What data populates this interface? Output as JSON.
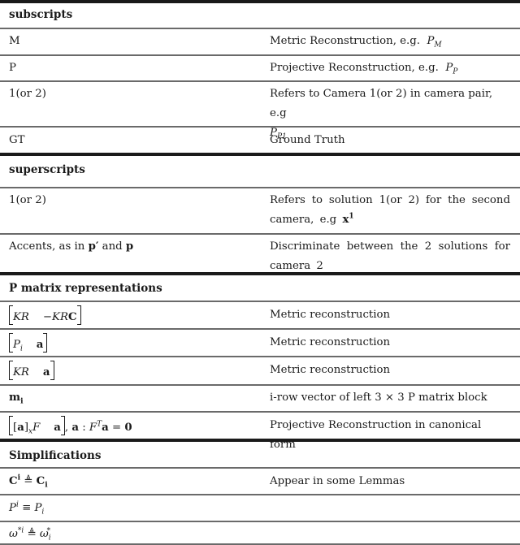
{
  "sections": [
    {
      "header": "subscripts",
      "rows": [
        {
          "symbol": "M",
          "description": "Metric Reconstruction, e.g.",
          "desc_math": "P",
          "desc_math_sub": "M"
        },
        {
          "symbol": "P",
          "description": "Projective Reconstruction, e.g.",
          "desc_math": "P",
          "desc_math_sub": "P"
        },
        {
          "symbol": "1(or 2)",
          "description": "Refers to Camera 1(or 2) in camera pair, e.g",
          "desc_math": "P",
          "desc_math_sub": "P1"
        },
        {
          "symbol": "GT",
          "description": "Ground Truth"
        }
      ]
    },
    {
      "header": "superscripts",
      "rows": [
        {
          "symbol": "1(or 2)",
          "description": "Refers to solution 1(or 2) for the second camera, e.g",
          "desc_math": "x",
          "desc_math_sup": "1"
        },
        {
          "symbol": "Accents, as in",
          "symbol_math_1": "p′",
          "symbol_and": "and",
          "symbol_math_2": "p",
          "description": "Discriminate between the 2 solutions for camera 2"
        }
      ]
    },
    {
      "header": "P matrix representations",
      "rows": [
        {
          "symbol": "[KR   −KRC]",
          "sym_a": "KR",
          "sym_b": "−KR",
          "sym_b_bold": "C",
          "description": "Metric reconstruction"
        },
        {
          "symbol": "[Pi   a]",
          "sym_a": "P",
          "sym_a_sub": "i",
          "sym_b_bold": "a",
          "description": "Metric reconstruction"
        },
        {
          "symbol": "[KR   a]",
          "sym_a": "KR",
          "sym_b_bold": "a",
          "description": "Metric reconstruction"
        },
        {
          "symbol": "mi",
          "sym_bold": "m",
          "sym_bold_sub": "i",
          "description": "i-row vector of left 3 × 3 P matrix block"
        },
        {
          "symbol": "[[a]xF   a], a : F^T a = 0",
          "sym_a_bold": "a",
          "sym_a_sub": "x",
          "sym_a_tail": "F",
          "sym_b_bold": "a",
          "sym_rest_1": ", ",
          "sym_rest_a": "a",
          "sym_rest_2": " : ",
          "sym_rest_F": "F",
          "sym_rest_sup": "T",
          "sym_rest_a2": "a",
          "sym_rest_3": " = ",
          "sym_rest_zero": "0",
          "description": "Projective Reconstruction in canonical form"
        }
      ]
    },
    {
      "header": "Simplifications",
      "rows": [
        {
          "symbol": "C^i ≜ C_i",
          "sym_l": "C",
          "sym_l_sup": "i",
          "op": " ≜ ",
          "sym_r": "C",
          "sym_r_sub": "i",
          "description": "Appear in some Lemmas"
        },
        {
          "symbol": "P^i ≡ P_i",
          "sym_l": "P",
          "sym_l_sup": "i",
          "op": " ≡ ",
          "sym_r": "P",
          "sym_r_sub": "i",
          "description": ""
        },
        {
          "symbol": "ω^{*i} ≜ ω_i^*",
          "sym_l": "ω",
          "sym_l_sup": "*i",
          "op": " ≜ ",
          "sym_r": "ω",
          "sym_r_sub": "i",
          "sym_r_sup": "*",
          "description": ""
        }
      ]
    }
  ]
}
